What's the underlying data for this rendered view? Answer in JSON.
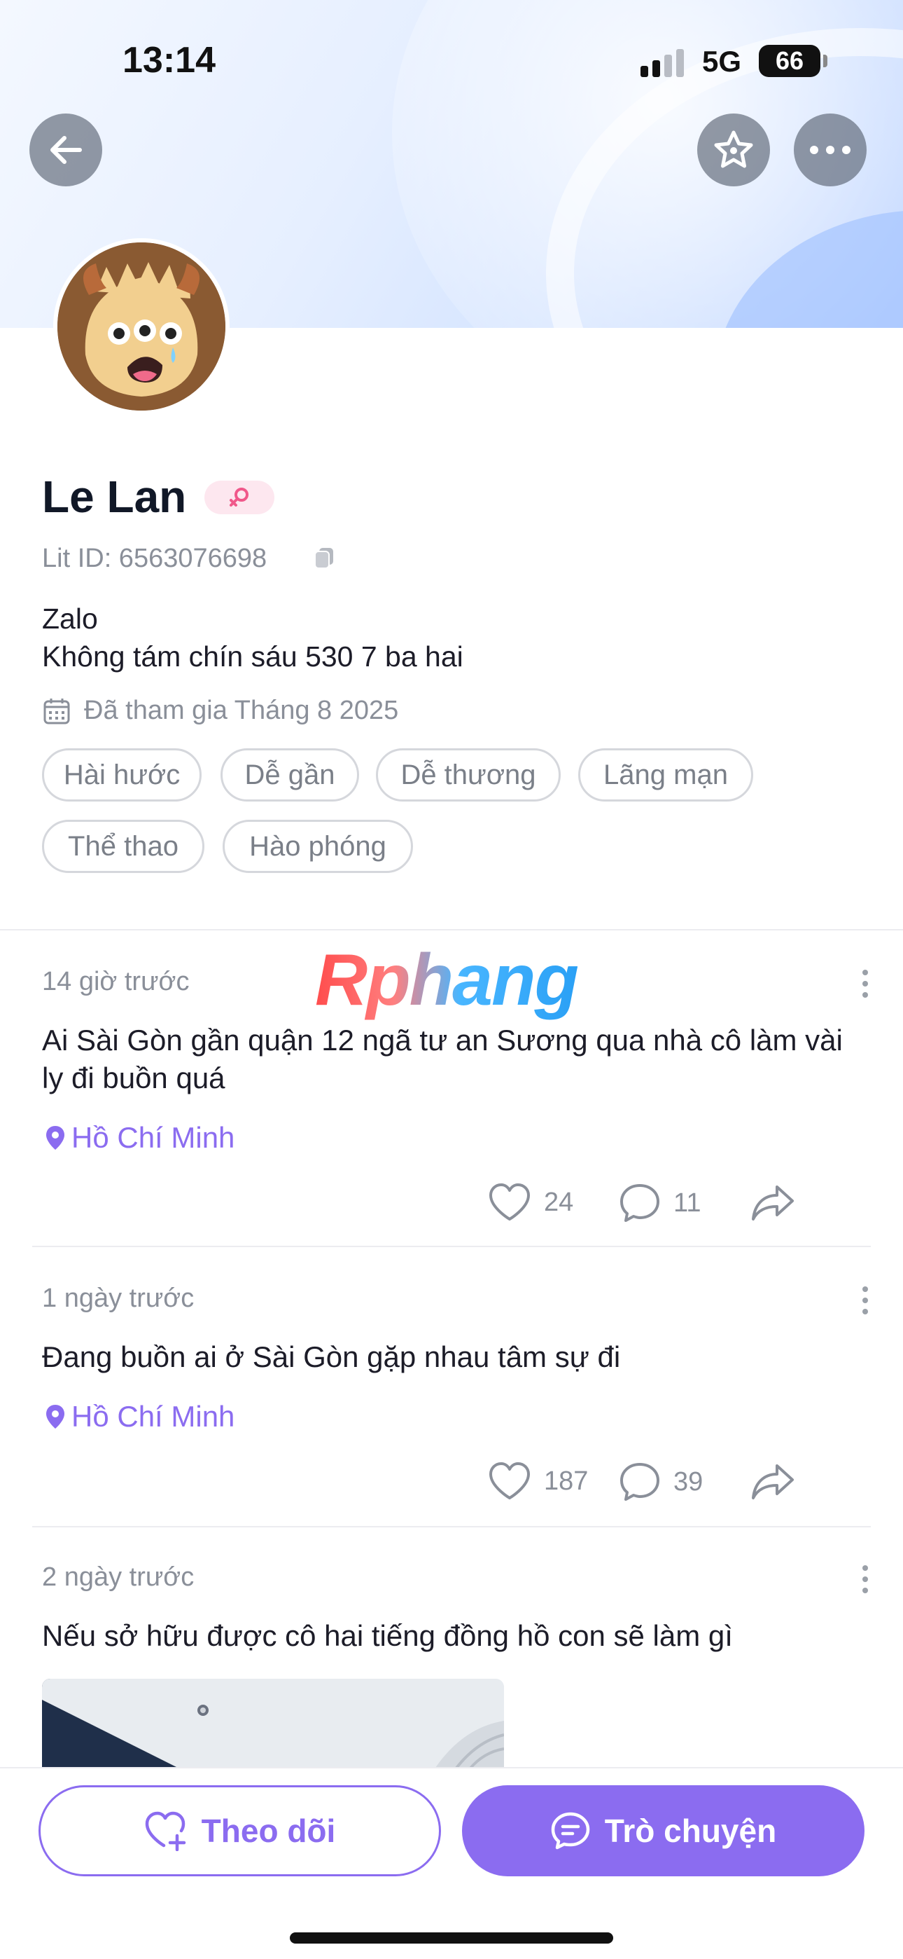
{
  "status_bar": {
    "time": "13:14",
    "network": "5G",
    "battery": "66"
  },
  "profile": {
    "name": "Le Lan",
    "lit_id": "Lit ID: 6563076698",
    "bio_line1": "Zalo",
    "bio_line2": "Không tám chín sáu 530 7 ba hai",
    "joined": "Đã tham gia Tháng 8 2025",
    "tags": [
      "Hài hước",
      "Dễ gần",
      "Dễ thương",
      "Lãng mạn",
      "Thể thao",
      "Hào phóng"
    ]
  },
  "watermark": "Rphang",
  "posts": [
    {
      "time": "14 giờ trước",
      "text": "Ai Sài Gòn gần quận 12 ngã tư an Sương qua nhà cô làm vài ly đi buồn quá",
      "location": "Hồ Chí Minh",
      "likes": "24",
      "comments": "11"
    },
    {
      "time": "1 ngày trước",
      "text": "Đang buồn ai ở Sài Gòn gặp nhau tâm sự đi",
      "location": "Hồ Chí Minh",
      "likes": "187",
      "comments": "39"
    },
    {
      "time": "2 ngày trước",
      "text": "Nếu sở hữu được cô hai tiếng đồng hồ con sẽ làm gì"
    }
  ],
  "bottom_bar": {
    "follow_label": "Theo dõi",
    "chat_label": "Trò chuyện"
  },
  "colors": {
    "accent": "#8b6cf0",
    "muted": "#8a8f99",
    "gender_badge_bg": "#fde7ef",
    "gender_icon": "#f0588a"
  }
}
